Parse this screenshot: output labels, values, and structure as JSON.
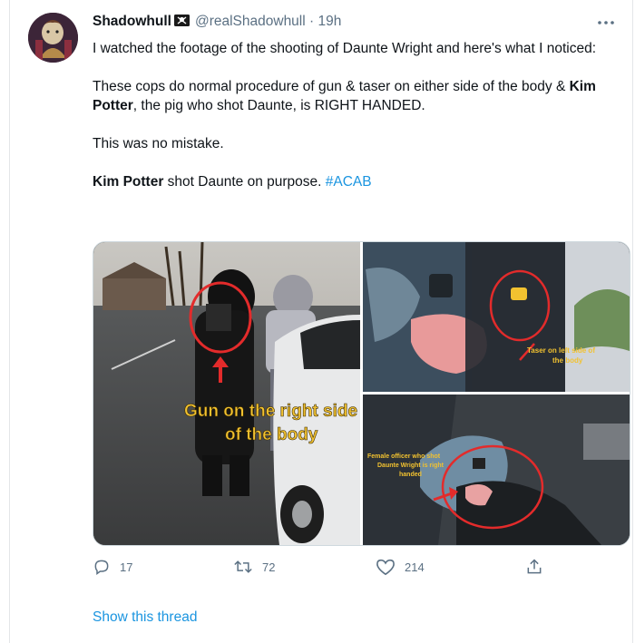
{
  "tweet": {
    "display_name": "Shadowhull",
    "handle": "@realShadowhull",
    "separator": "·",
    "time": "19h",
    "more_icon": "more-horizontal-icon",
    "paragraphs": {
      "p1": "I watched the footage of the shooting of Daunte Wright and here's what I noticed:",
      "p2_part1": "These cops do normal procedure of gun & taser on either side of the body & ",
      "p2_bold": "Kim Potter",
      "p2_part2": ", the pig who shot Daunte, is RIGHT HANDED.",
      "p3": "This was no mistake.",
      "p4_bold": "Kim Potter",
      "p4_part": " shot Daunte on purpose. ",
      "p4_hashtag": "#ACAB"
    },
    "media": {
      "left_caption_line1": "Gun on the right side",
      "left_caption_line2": "of the body",
      "top_right_caption_line1": "Taser on left side of",
      "top_right_caption_line2": "the body",
      "bottom_right_caption_line1": "Female officer who shot",
      "bottom_right_caption_line2": "Daunte Wright is right",
      "bottom_right_caption_line3": "handed"
    },
    "actions": {
      "reply_count": "17",
      "retweet_count": "72",
      "like_count": "214"
    },
    "show_thread": "Show this thread"
  },
  "colors": {
    "link": "#1b95e0",
    "secondary_text": "#5b7083",
    "annotation_red": "#e32b2b",
    "caption_yellow": "#f2c230"
  }
}
